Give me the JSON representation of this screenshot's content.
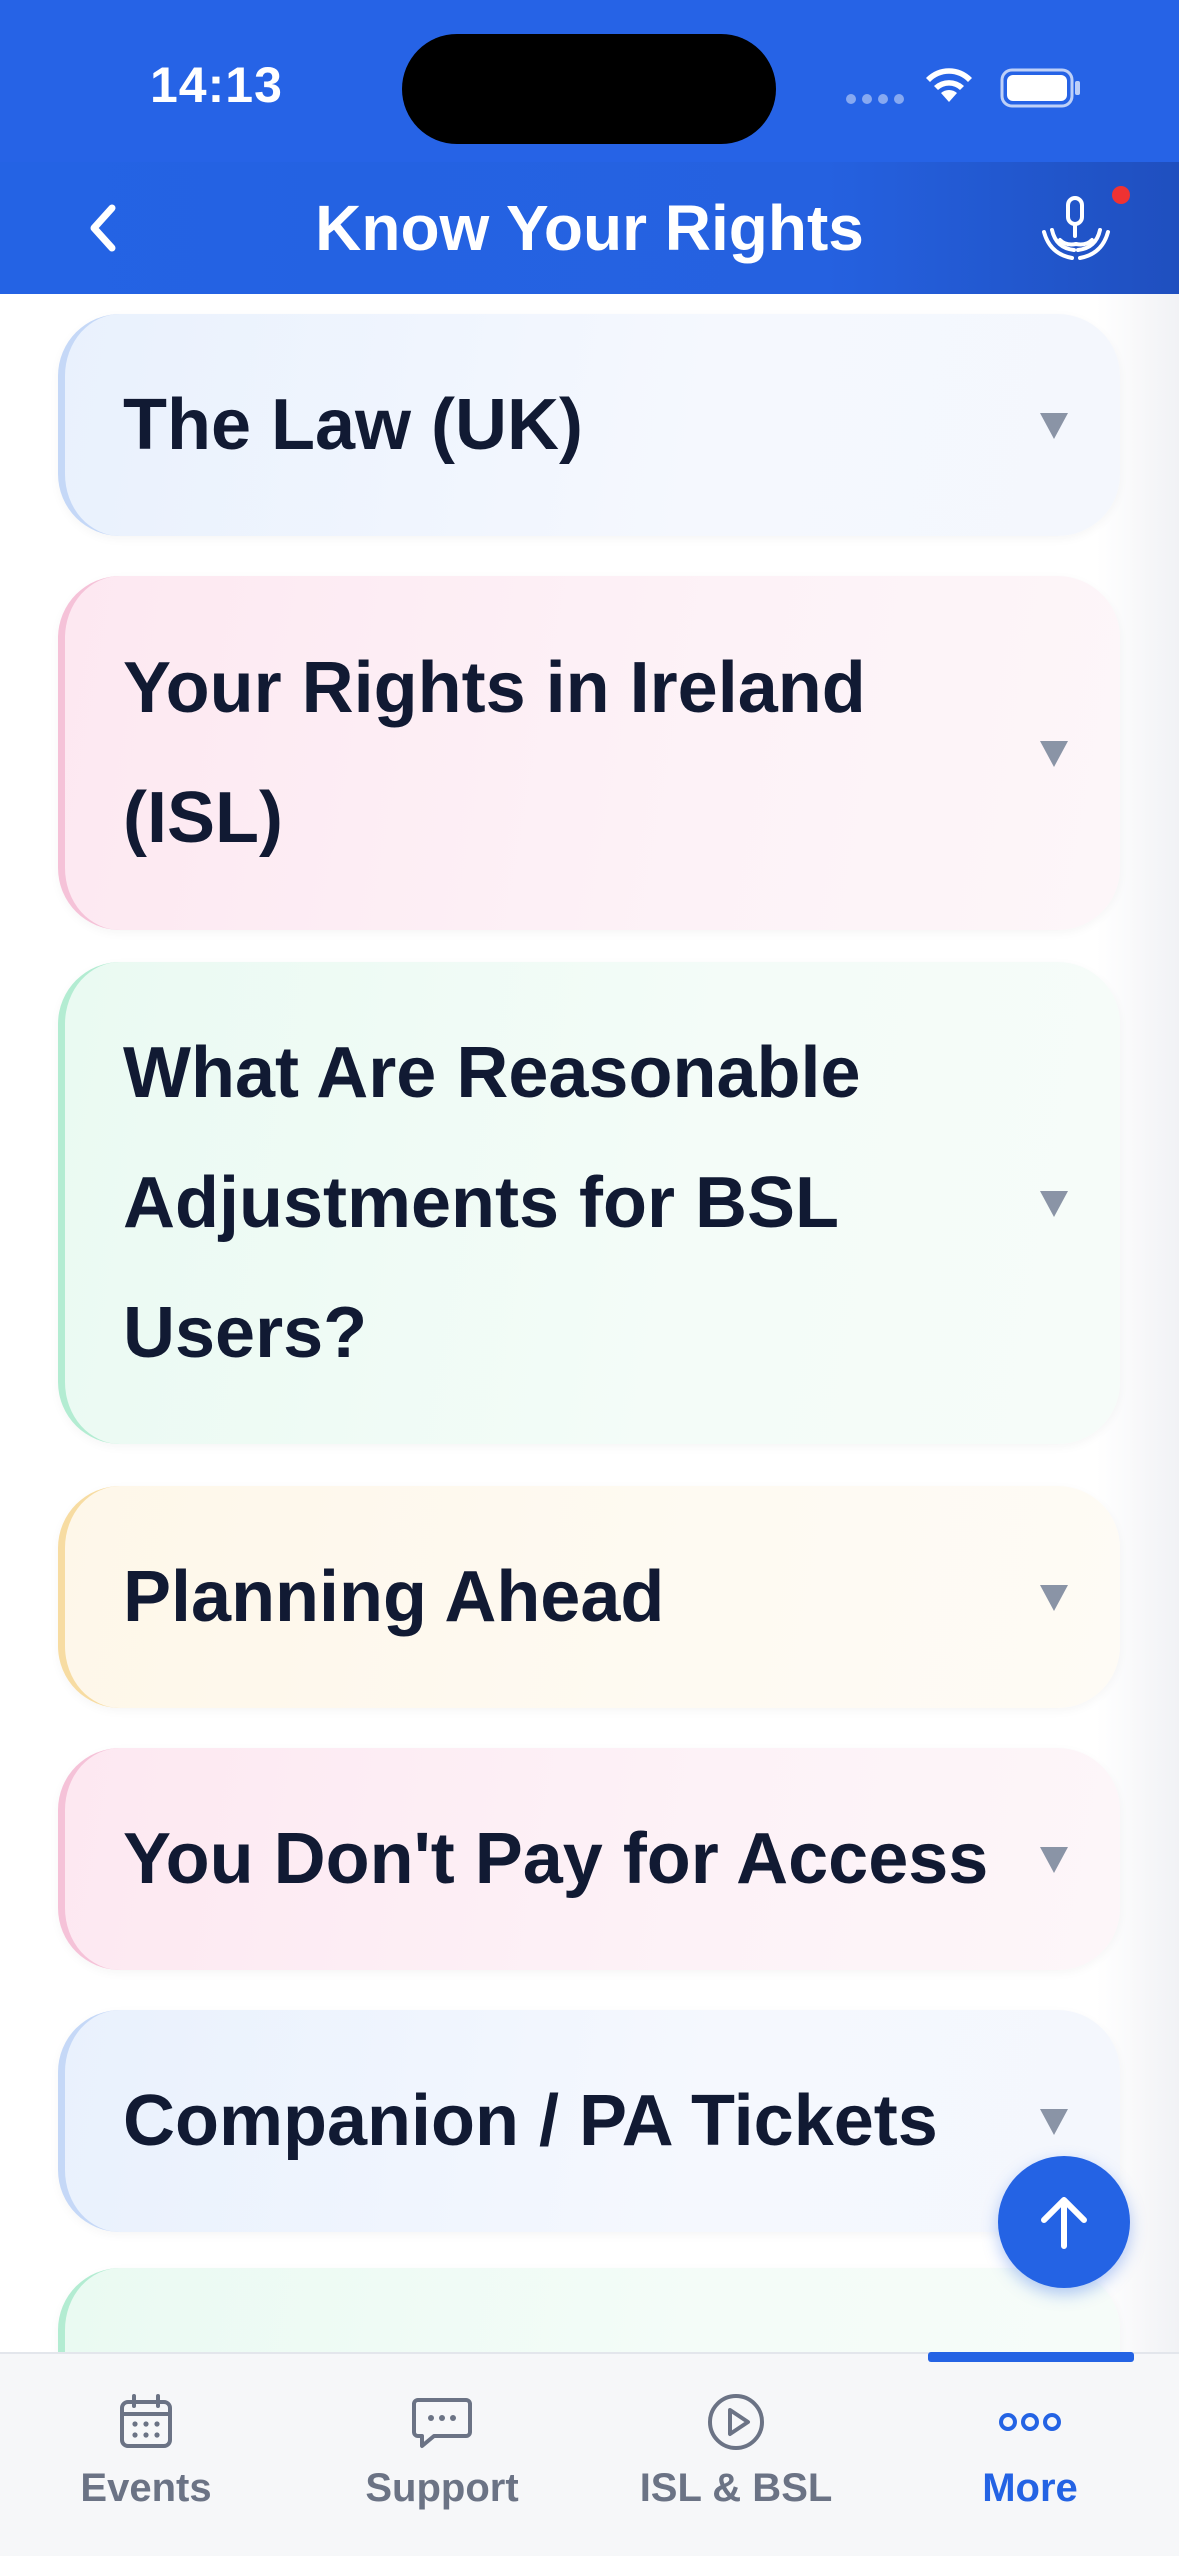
{
  "status_bar": {
    "time": "14:13"
  },
  "header": {
    "title": "Know Your Rights"
  },
  "sections": [
    {
      "title": "The Law (UK)",
      "color": "#e9f1fd",
      "accent": "#c5d8f7"
    },
    {
      "title": "Your Rights in Ireland (ISL)",
      "color": "#fde8f1",
      "accent": "#f5c2d8"
    },
    {
      "title": "What Are Reasonable Adjustments for BSL Users?",
      "color": "#eafaf2",
      "accent": "#b3ecd2"
    },
    {
      "title": "Planning Ahead",
      "color": "#fef7e9",
      "accent": "#f7dca2"
    },
    {
      "title": "You Don't Pay for Access",
      "color": "#fde8f1",
      "accent": "#f5c2d8"
    },
    {
      "title": "Companion / PA Tickets",
      "color": "#e9f1fd",
      "accent": "#c5d8f7"
    }
  ],
  "tabs": [
    {
      "label": "Events",
      "icon": "calendar-icon"
    },
    {
      "label": "Support",
      "icon": "chat-bubble-icon"
    },
    {
      "label": "ISL & BSL",
      "icon": "play-circle-icon"
    },
    {
      "label": "More",
      "icon": "more-dots-icon",
      "active": true
    }
  ],
  "colors": {
    "primary": "#2463e4",
    "text": "#111a33",
    "notification": "#ef3232"
  }
}
